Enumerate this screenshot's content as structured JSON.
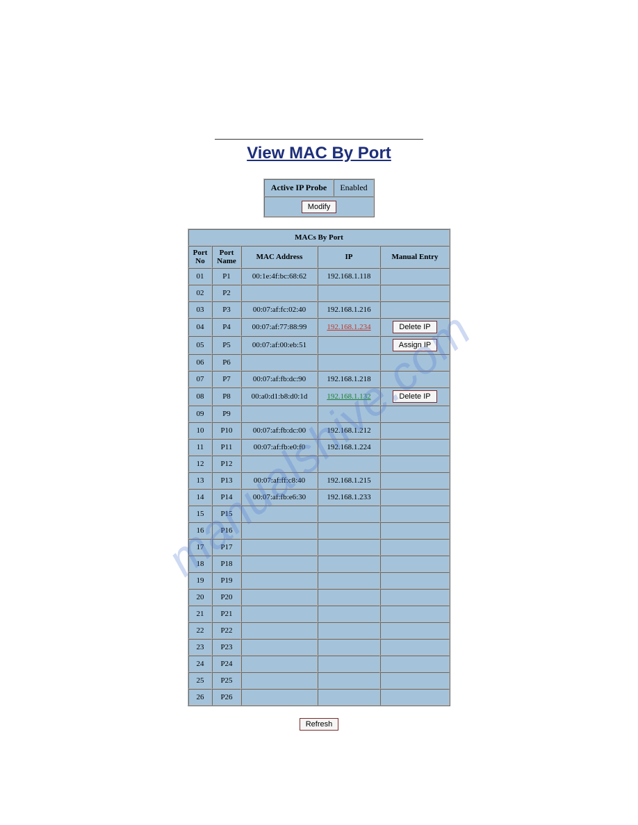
{
  "title": "View MAC By Port",
  "probe": {
    "label": "Active IP Probe",
    "status": "Enabled",
    "modify": "Modify"
  },
  "table": {
    "caption": "MACs By Port",
    "headers": {
      "port_no": "Port No",
      "port_name": "Port Name",
      "mac": "MAC Address",
      "ip": "IP",
      "manual": "Manual Entry"
    },
    "rows": [
      {
        "no": "01",
        "name": "P1",
        "mac": "00:1e:4f:bc:68:62",
        "ip": "192.168.1.118",
        "ip_style": "",
        "manual": ""
      },
      {
        "no": "02",
        "name": "P2",
        "mac": "",
        "ip": "",
        "ip_style": "",
        "manual": ""
      },
      {
        "no": "03",
        "name": "P3",
        "mac": "00:07:af:fc:02:40",
        "ip": "192.168.1.216",
        "ip_style": "",
        "manual": ""
      },
      {
        "no": "04",
        "name": "P4",
        "mac": "00:07:af:77:88:99",
        "ip": "192.168.1.234",
        "ip_style": "red",
        "manual": "Delete IP"
      },
      {
        "no": "05",
        "name": "P5",
        "mac": "00:07:af:00:eb:51",
        "ip": "",
        "ip_style": "",
        "manual": "Assign IP"
      },
      {
        "no": "06",
        "name": "P6",
        "mac": "",
        "ip": "",
        "ip_style": "",
        "manual": ""
      },
      {
        "no": "07",
        "name": "P7",
        "mac": "00:07:af:fb:dc:90",
        "ip": "192.168.1.218",
        "ip_style": "",
        "manual": ""
      },
      {
        "no": "08",
        "name": "P8",
        "mac": "00:a0:d1:b8:d0:1d",
        "ip": "192.168.1.132",
        "ip_style": "green",
        "manual": "Delete IP"
      },
      {
        "no": "09",
        "name": "P9",
        "mac": "",
        "ip": "",
        "ip_style": "",
        "manual": ""
      },
      {
        "no": "10",
        "name": "P10",
        "mac": "00:07:af:fb:dc:00",
        "ip": "192.168.1.212",
        "ip_style": "",
        "manual": ""
      },
      {
        "no": "11",
        "name": "P11",
        "mac": "00:07:af:fb:e0:f0",
        "ip": "192.168.1.224",
        "ip_style": "",
        "manual": ""
      },
      {
        "no": "12",
        "name": "P12",
        "mac": "",
        "ip": "",
        "ip_style": "",
        "manual": ""
      },
      {
        "no": "13",
        "name": "P13",
        "mac": "00:07:af:ff:c8:40",
        "ip": "192.168.1.215",
        "ip_style": "",
        "manual": ""
      },
      {
        "no": "14",
        "name": "P14",
        "mac": "00:07:af:fb:e6:30",
        "ip": "192.168.1.233",
        "ip_style": "",
        "manual": ""
      },
      {
        "no": "15",
        "name": "P15",
        "mac": "",
        "ip": "",
        "ip_style": "",
        "manual": ""
      },
      {
        "no": "16",
        "name": "P16",
        "mac": "",
        "ip": "",
        "ip_style": "",
        "manual": ""
      },
      {
        "no": "17",
        "name": "P17",
        "mac": "",
        "ip": "",
        "ip_style": "",
        "manual": ""
      },
      {
        "no": "18",
        "name": "P18",
        "mac": "",
        "ip": "",
        "ip_style": "",
        "manual": ""
      },
      {
        "no": "19",
        "name": "P19",
        "mac": "",
        "ip": "",
        "ip_style": "",
        "manual": ""
      },
      {
        "no": "20",
        "name": "P20",
        "mac": "",
        "ip": "",
        "ip_style": "",
        "manual": ""
      },
      {
        "no": "21",
        "name": "P21",
        "mac": "",
        "ip": "",
        "ip_style": "",
        "manual": ""
      },
      {
        "no": "22",
        "name": "P22",
        "mac": "",
        "ip": "",
        "ip_style": "",
        "manual": ""
      },
      {
        "no": "23",
        "name": "P23",
        "mac": "",
        "ip": "",
        "ip_style": "",
        "manual": ""
      },
      {
        "no": "24",
        "name": "P24",
        "mac": "",
        "ip": "",
        "ip_style": "",
        "manual": ""
      },
      {
        "no": "25",
        "name": "P25",
        "mac": "",
        "ip": "",
        "ip_style": "",
        "manual": ""
      },
      {
        "no": "26",
        "name": "P26",
        "mac": "",
        "ip": "",
        "ip_style": "",
        "manual": ""
      }
    ]
  },
  "refresh": "Refresh",
  "watermark": "manualshive.com"
}
